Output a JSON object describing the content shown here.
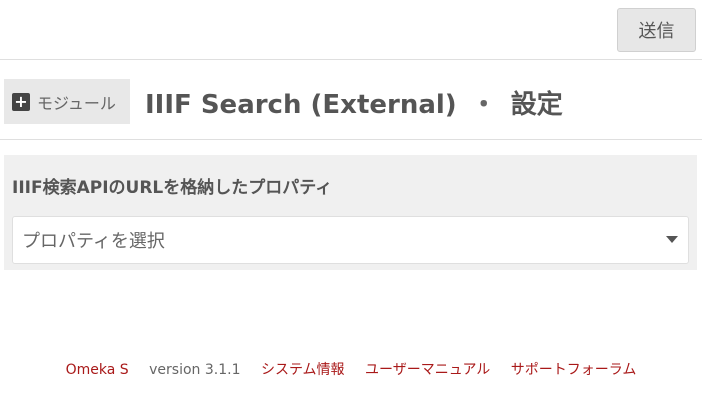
{
  "toolbar": {
    "submit_label": "送信"
  },
  "header": {
    "module_label": "モジュール",
    "module_icon": "plus-square-icon",
    "title": "IIIF Search (External)",
    "separator": "・",
    "subtitle": "設定"
  },
  "form": {
    "field_label": "IIIF検索APIのURLを格納したプロパティ",
    "select_value": "プロパティを選択",
    "select_icon": "caret-down-icon"
  },
  "footer": {
    "brand": "Omeka S",
    "version": "version 3.1.1",
    "links": [
      "システム情報",
      "ユーザーマニュアル",
      "サポートフォーラム"
    ]
  },
  "colors": {
    "link": "#a91919",
    "panel_bg": "#f0f0f0",
    "button_bg": "#e7e7e7"
  }
}
